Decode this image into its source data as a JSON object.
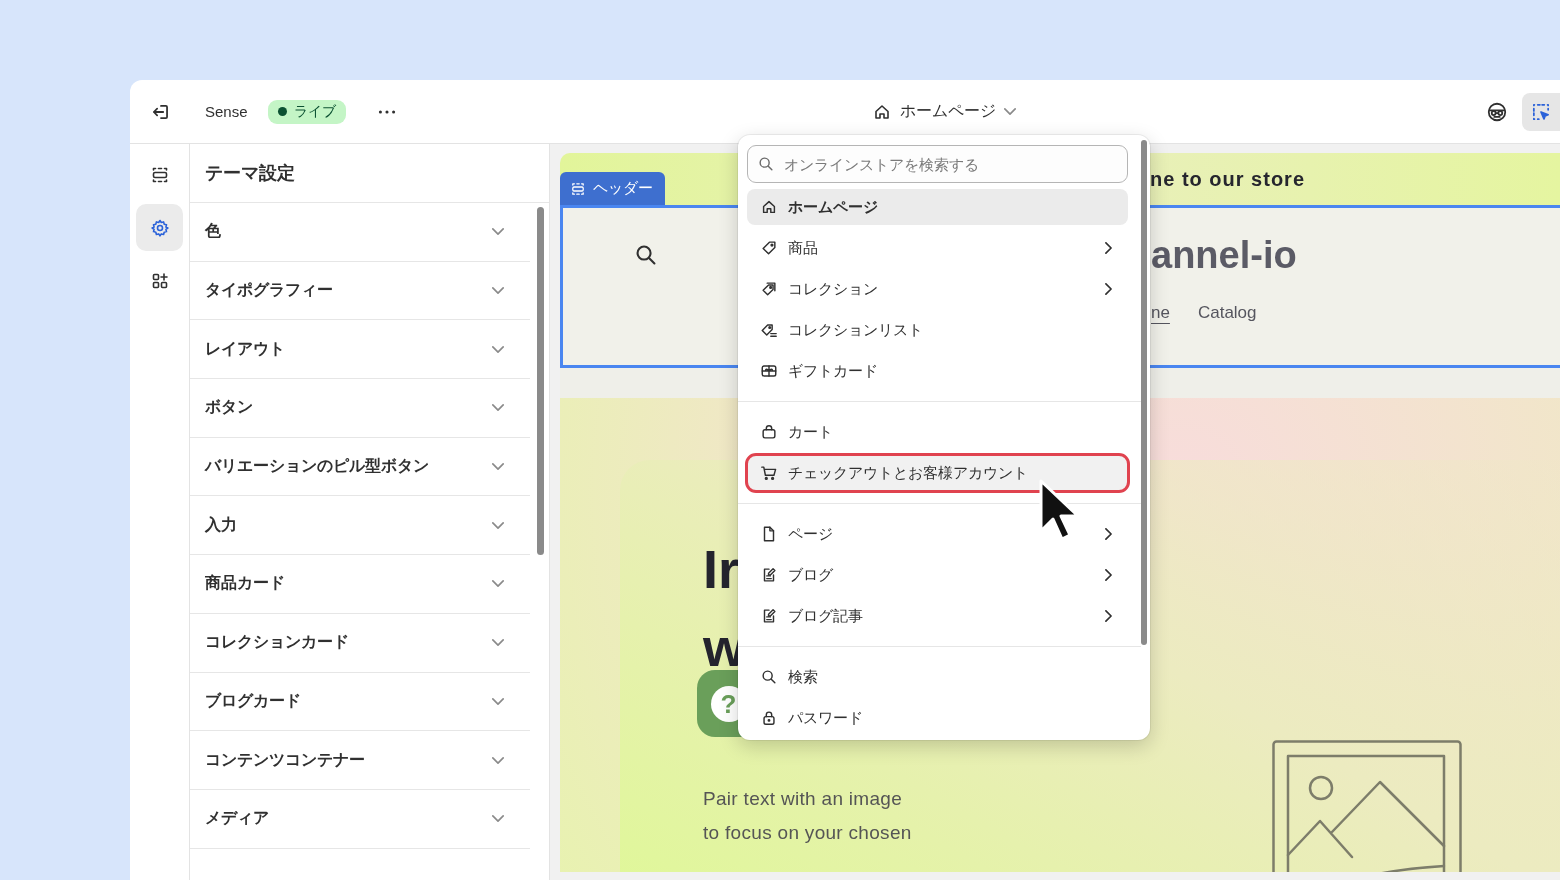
{
  "topbar": {
    "store_name": "Sense",
    "status": "ライブ",
    "page_selector": "ホームページ",
    "tools": [
      {
        "kind": "incognito",
        "selected": false
      },
      {
        "kind": "inspector",
        "selected": true
      }
    ]
  },
  "rail": [
    {
      "kind": "sections",
      "selected": false
    },
    {
      "kind": "settings",
      "selected": true
    },
    {
      "kind": "apps",
      "selected": false
    }
  ],
  "settings": {
    "title": "テーマ設定",
    "sections": [
      {
        "label": "色",
        "expanded": false
      },
      {
        "label": "タイポグラフィー",
        "expanded": false
      },
      {
        "label": "レイアウト",
        "expanded": false
      },
      {
        "label": "ボタン",
        "expanded": false
      },
      {
        "label": "バリエーションのピル型ボタン",
        "expanded": false
      },
      {
        "label": "入力",
        "expanded": false
      },
      {
        "label": "商品カード",
        "expanded": false
      },
      {
        "label": "コレクションカード",
        "expanded": false
      },
      {
        "label": "ブログカード",
        "expanded": false
      },
      {
        "label": "コンテンツコンテナー",
        "expanded": false
      },
      {
        "label": "メディア",
        "expanded": false
      }
    ]
  },
  "preview": {
    "announcement": "ne to our store",
    "header_tag": "ヘッダー",
    "logo": "annel-io",
    "nav": [
      {
        "label": "ne",
        "selected": true
      },
      {
        "label": "Catalog",
        "selected": false
      }
    ],
    "hero": {
      "heading_lines": [
        "Ir",
        "w"
      ],
      "body_lines": [
        "Pair text with an image",
        "to focus on your chosen"
      ]
    },
    "help_button": "?"
  },
  "dropdown": {
    "search": {
      "placeholder": "オンラインストアを検索する"
    },
    "groups": [
      {
        "items": [
          {
            "kind": "home",
            "label": "ホームページ",
            "has_submenu": false,
            "selected": true,
            "highlighted": false
          },
          {
            "kind": "tag",
            "label": "商品",
            "has_submenu": true,
            "selected": false,
            "highlighted": false
          },
          {
            "kind": "tags",
            "label": "コレクション",
            "has_submenu": true,
            "selected": false,
            "highlighted": false
          },
          {
            "kind": "tag-list",
            "label": "コレクションリスト",
            "has_submenu": false,
            "selected": false,
            "highlighted": false
          },
          {
            "kind": "gift-card",
            "label": "ギフトカード",
            "has_submenu": false,
            "selected": false,
            "highlighted": false
          }
        ]
      },
      {
        "items": [
          {
            "kind": "bag",
            "label": "カート",
            "has_submenu": false,
            "selected": false,
            "highlighted": false
          },
          {
            "kind": "cart",
            "label": "チェックアウトとお客様アカウント",
            "has_submenu": false,
            "selected": false,
            "highlighted": true
          }
        ]
      },
      {
        "items": [
          {
            "kind": "page",
            "label": "ページ",
            "has_submenu": true,
            "selected": false,
            "highlighted": false
          },
          {
            "kind": "blog",
            "label": "ブログ",
            "has_submenu": true,
            "selected": false,
            "highlighted": false
          },
          {
            "kind": "blog",
            "label": "ブログ記事",
            "has_submenu": true,
            "selected": false,
            "highlighted": false
          }
        ]
      },
      {
        "items": [
          {
            "kind": "search",
            "label": "検索",
            "has_submenu": false,
            "selected": false,
            "highlighted": false
          },
          {
            "kind": "lock",
            "label": "パスワード",
            "has_submenu": false,
            "selected": false,
            "highlighted": false
          }
        ]
      }
    ]
  }
}
